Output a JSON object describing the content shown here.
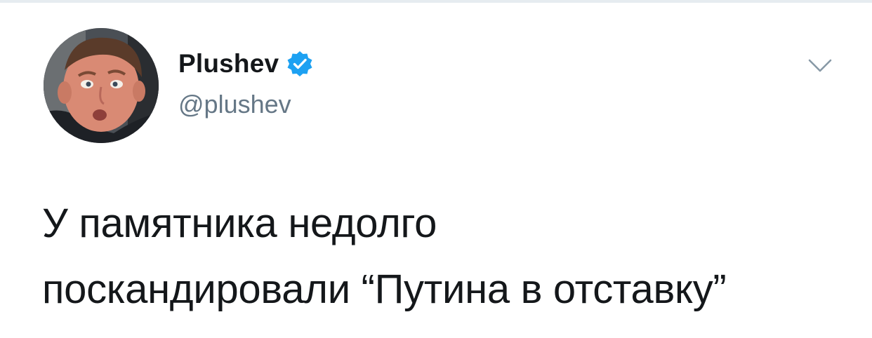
{
  "tweet": {
    "author": {
      "display_name": "Plushev",
      "handle": "@plushev",
      "verified": true
    },
    "text_lines": [
      "У памятника недолго",
      "поскандировали “Путина в отставку”"
    ]
  },
  "icons": {
    "verified": "verified-badge-icon",
    "menu": "chevron-down-icon"
  },
  "colors": {
    "verified_blue": "#1da1f2",
    "text_primary": "#14171a",
    "text_secondary": "#657786",
    "divider": "#e6ecf0"
  }
}
